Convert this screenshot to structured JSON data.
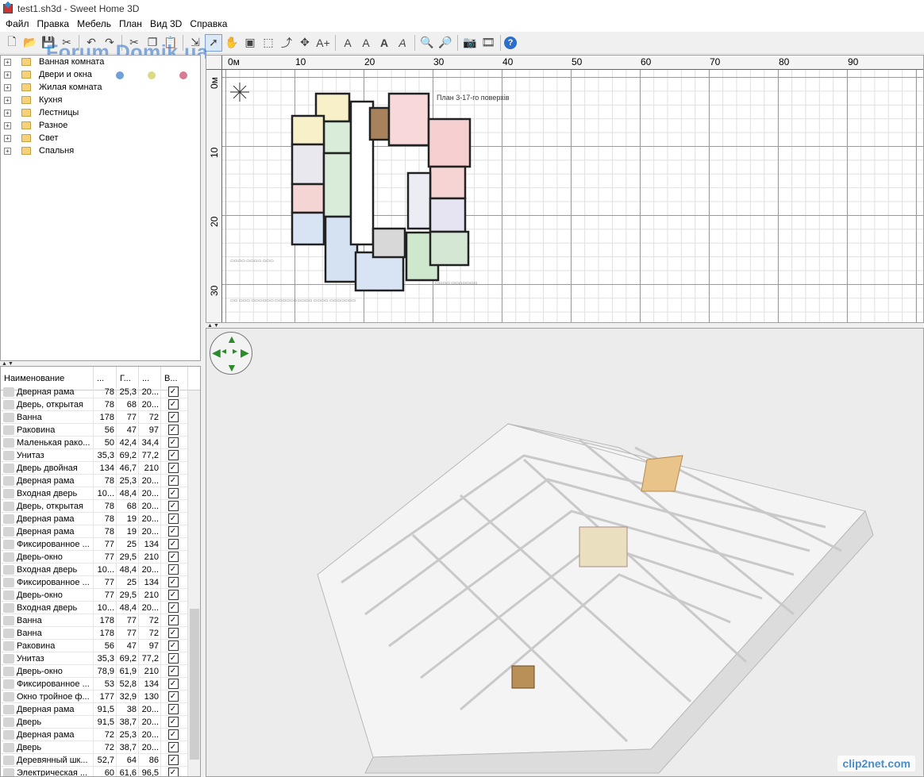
{
  "window": {
    "title": "test1.sh3d - Sweet Home 3D"
  },
  "menu": [
    "Файл",
    "Правка",
    "Мебель",
    "План",
    "Вид 3D",
    "Справка"
  ],
  "watermark": "Forum.Domik.ua",
  "catalog": {
    "categories": [
      "Ванная комната",
      "Двери и окна",
      "Жилая комната",
      "Кухня",
      "Лестницы",
      "Разное",
      "Свет",
      "Спальня"
    ],
    "colors": [
      "#6fa0d8",
      "#d9dc86",
      "#d97b93"
    ]
  },
  "furniture": {
    "headers": [
      "Наименование",
      "...",
      "Г...",
      "...",
      "В..."
    ],
    "rows": [
      {
        "name": "Дверная рама",
        "w": "78",
        "d": "25,3",
        "h": "20...",
        "v": true
      },
      {
        "name": "Дверь, открытая",
        "w": "78",
        "d": "68",
        "h": "20...",
        "v": true
      },
      {
        "name": "Ванна",
        "w": "178",
        "d": "77",
        "h": "72",
        "v": true
      },
      {
        "name": "Раковина",
        "w": "56",
        "d": "47",
        "h": "97",
        "v": true
      },
      {
        "name": "Маленькая рако...",
        "w": "50",
        "d": "42,4",
        "h": "34,4",
        "v": true
      },
      {
        "name": "Унитаз",
        "w": "35,3",
        "d": "69,2",
        "h": "77,2",
        "v": true
      },
      {
        "name": "Дверь двойная",
        "w": "134",
        "d": "46,7",
        "h": "210",
        "v": true
      },
      {
        "name": "Дверная рама",
        "w": "78",
        "d": "25,3",
        "h": "20...",
        "v": true
      },
      {
        "name": "Входная дверь",
        "w": "10...",
        "d": "48,4",
        "h": "20...",
        "v": true
      },
      {
        "name": "Дверь, открытая",
        "w": "78",
        "d": "68",
        "h": "20...",
        "v": true
      },
      {
        "name": "Дверная рама",
        "w": "78",
        "d": "19",
        "h": "20...",
        "v": true
      },
      {
        "name": "Дверная рама",
        "w": "78",
        "d": "19",
        "h": "20...",
        "v": true
      },
      {
        "name": "Фиксированное ...",
        "w": "77",
        "d": "25",
        "h": "134",
        "v": true
      },
      {
        "name": "Дверь-окно",
        "w": "77",
        "d": "29,5",
        "h": "210",
        "v": true
      },
      {
        "name": "Входная дверь",
        "w": "10...",
        "d": "48,4",
        "h": "20...",
        "v": true
      },
      {
        "name": "Фиксированное ...",
        "w": "77",
        "d": "25",
        "h": "134",
        "v": true
      },
      {
        "name": "Дверь-окно",
        "w": "77",
        "d": "29,5",
        "h": "210",
        "v": true
      },
      {
        "name": "Входная дверь",
        "w": "10...",
        "d": "48,4",
        "h": "20...",
        "v": true
      },
      {
        "name": "Ванна",
        "w": "178",
        "d": "77",
        "h": "72",
        "v": true
      },
      {
        "name": "Ванна",
        "w": "178",
        "d": "77",
        "h": "72",
        "v": true
      },
      {
        "name": "Раковина",
        "w": "56",
        "d": "47",
        "h": "97",
        "v": true
      },
      {
        "name": "Унитаз",
        "w": "35,3",
        "d": "69,2",
        "h": "77,2",
        "v": true
      },
      {
        "name": "Дверь-окно",
        "w": "78,9",
        "d": "61,9",
        "h": "210",
        "v": true
      },
      {
        "name": "Фиксированное ...",
        "w": "53",
        "d": "52,8",
        "h": "134",
        "v": true
      },
      {
        "name": "Окно тройное ф...",
        "w": "177",
        "d": "32,9",
        "h": "130",
        "v": true
      },
      {
        "name": "Дверная рама",
        "w": "91,5",
        "d": "38",
        "h": "20...",
        "v": true
      },
      {
        "name": "Дверь",
        "w": "91,5",
        "d": "38,7",
        "h": "20...",
        "v": true
      },
      {
        "name": "Дверная рама",
        "w": "72",
        "d": "25,3",
        "h": "20...",
        "v": true
      },
      {
        "name": "Дверь",
        "w": "72",
        "d": "38,7",
        "h": "20...",
        "v": true
      },
      {
        "name": "Деревянный шк...",
        "w": "52,7",
        "d": "64",
        "h": "86",
        "v": true
      },
      {
        "name": "Электрическая ...",
        "w": "60",
        "d": "61,6",
        "h": "96,5",
        "v": true
      }
    ]
  },
  "plan": {
    "ruler_top": [
      "0м",
      "10",
      "20",
      "30",
      "40",
      "50",
      "60",
      "70",
      "80",
      "90"
    ],
    "ruler_left": [
      "0м",
      "10",
      "20",
      "30"
    ],
    "title": "План 3-17-го поверхів"
  },
  "footer_mark": "clip2net.com"
}
